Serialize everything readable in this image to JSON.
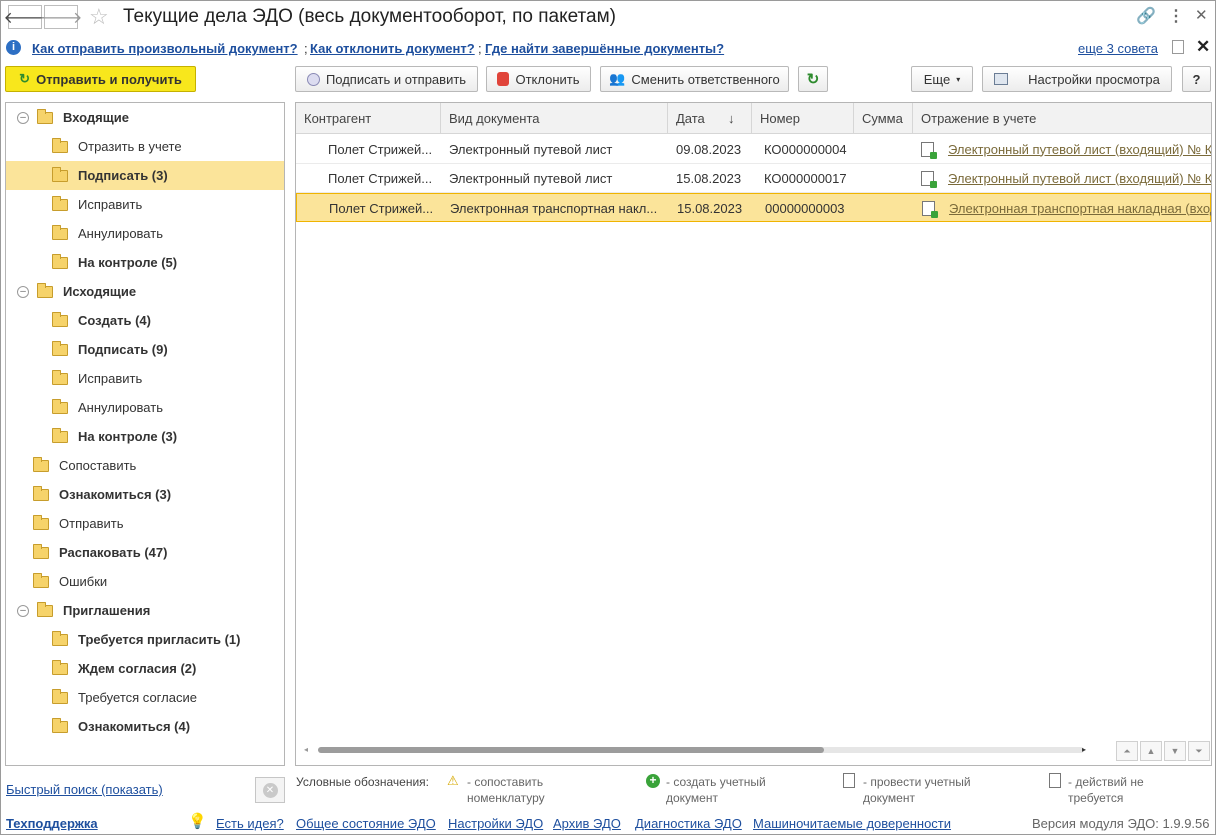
{
  "window": {
    "title": "Текущие дела ЭДО (весь документооборот, по пакетам)"
  },
  "tips": {
    "link1": "Как отправить произвольный документ?",
    "link2": "Как отклонить документ?",
    "link3": "Где найти завершённые документы?",
    "more": "еще 3 совета"
  },
  "toolbar": {
    "send_receive": "Отправить и получить",
    "sign_send": "Подписать и отправить",
    "reject": "Отклонить",
    "change_owner": "Сменить ответственного",
    "more": "Еще",
    "view_settings": "Настройки просмотра",
    "help": "?"
  },
  "tree": [
    {
      "label": "Входящие",
      "bold": true,
      "level": 0,
      "collapse": true
    },
    {
      "label": "Отразить в учете",
      "bold": false,
      "level": 1
    },
    {
      "label": "Подписать (3)",
      "bold": true,
      "level": 1,
      "selected": true
    },
    {
      "label": "Исправить",
      "bold": false,
      "level": 1
    },
    {
      "label": "Аннулировать",
      "bold": false,
      "level": 1
    },
    {
      "label": "На контроле (5)",
      "bold": true,
      "level": 1
    },
    {
      "label": "Исходящие",
      "bold": true,
      "level": 0,
      "collapse": true
    },
    {
      "label": "Создать (4)",
      "bold": true,
      "level": 1
    },
    {
      "label": "Подписать (9)",
      "bold": true,
      "level": 1
    },
    {
      "label": "Исправить",
      "bold": false,
      "level": 1
    },
    {
      "label": "Аннулировать",
      "bold": false,
      "level": 1
    },
    {
      "label": "На контроле (3)",
      "bold": true,
      "level": 1
    },
    {
      "label": "Сопоставить",
      "bold": false,
      "level": 0
    },
    {
      "label": "Ознакомиться (3)",
      "bold": true,
      "level": 0
    },
    {
      "label": "Отправить",
      "bold": false,
      "level": 0
    },
    {
      "label": "Распаковать (47)",
      "bold": true,
      "level": 0
    },
    {
      "label": "Ошибки",
      "bold": false,
      "level": 0
    },
    {
      "label": "Приглашения",
      "bold": true,
      "level": 0,
      "collapse": true
    },
    {
      "label": "Требуется пригласить (1)",
      "bold": true,
      "level": 1
    },
    {
      "label": "Ждем согласия (2)",
      "bold": true,
      "level": 1
    },
    {
      "label": "Требуется согласие",
      "bold": false,
      "level": 1
    },
    {
      "label": "Ознакомиться (4)",
      "bold": true,
      "level": 1
    }
  ],
  "table": {
    "columns": [
      "Контрагент",
      "Вид документа",
      "Дата",
      "Номер",
      "Сумма",
      "Отражение в учете"
    ],
    "sort_indicator": "↓",
    "rows": [
      {
        "counterparty": "Полет Стрижей...",
        "doc_type": "Электронный путевой лист",
        "date": "09.08.2023",
        "number": "КО000000004",
        "sum": "",
        "reflection": "Электронный путевой лист (входящий) № К"
      },
      {
        "counterparty": "Полет Стрижей...",
        "doc_type": "Электронный путевой лист",
        "date": "15.08.2023",
        "number": "КО000000017",
        "sum": "",
        "reflection": "Электронный путевой лист (входящий) № К"
      },
      {
        "counterparty": "Полет Стрижей...",
        "doc_type": "Электронная транспортная накл...",
        "date": "15.08.2023",
        "number": "00000000003",
        "sum": "",
        "reflection": "Электронная транспортная накладная (вход",
        "selected": true
      }
    ]
  },
  "quick_search": "Быстрый поиск (показать)",
  "legend": {
    "title": "Условные обозначения:",
    "item1": "- сопоставить номенклатуру",
    "item2": "- создать учетный документ",
    "item3": "- провести учетный документ",
    "item4": "- действий не требуется"
  },
  "footer": {
    "support": "Техподдержка",
    "idea": "Есть идея?",
    "state": "Общее состояние ЭДО",
    "settings": "Настройки ЭДО",
    "archive": "Архив ЭДО",
    "diagnostics": "Диагностика ЭДО",
    "powers": "Машиночитаемые доверенности",
    "version": "Версия модуля ЭДО: 1.9.9.56"
  }
}
